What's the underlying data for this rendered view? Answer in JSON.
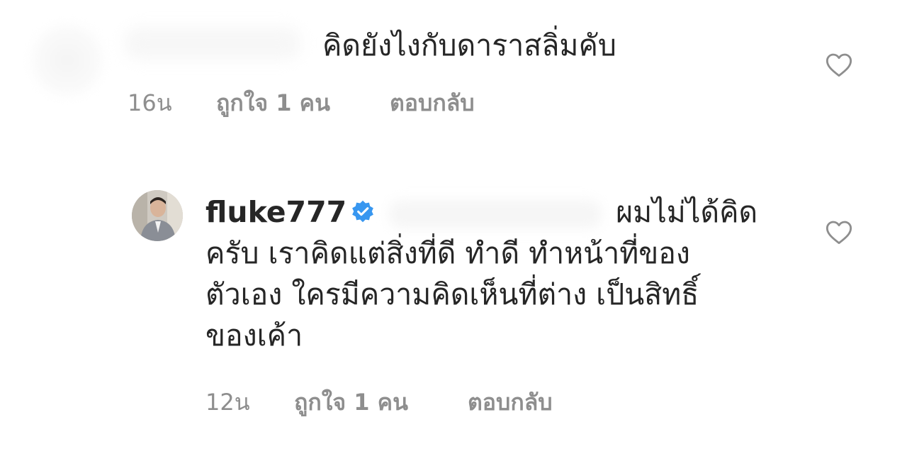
{
  "comments": [
    {
      "text": "คิดยังไงกับดาราสลิ่มคับ",
      "time": "16น",
      "likes": "ถูกใจ 1 คน",
      "reply": "ตอบกลับ",
      "heart_icon": "heart-outline-icon"
    },
    {
      "username": "fluke777",
      "verified_icon": "verified-badge-icon",
      "text_lines": [
        "ผมไม่ได้คิด",
        "ครับ เราคิดแต่สิ่งที่ดี ทำดี ทำหน้าที่ของ",
        "ตัวเอง ใครมีความคิดเห็นที่ต่าง เป็นสิทธิ์",
        "ของเค้า"
      ],
      "time": "12น",
      "likes": "ถูกใจ 1 คน",
      "reply": "ตอบกลับ",
      "heart_icon": "heart-outline-icon"
    }
  ],
  "colors": {
    "text_primary": "#262626",
    "text_secondary": "#8e8e8e",
    "verified_blue": "#3897f0"
  }
}
